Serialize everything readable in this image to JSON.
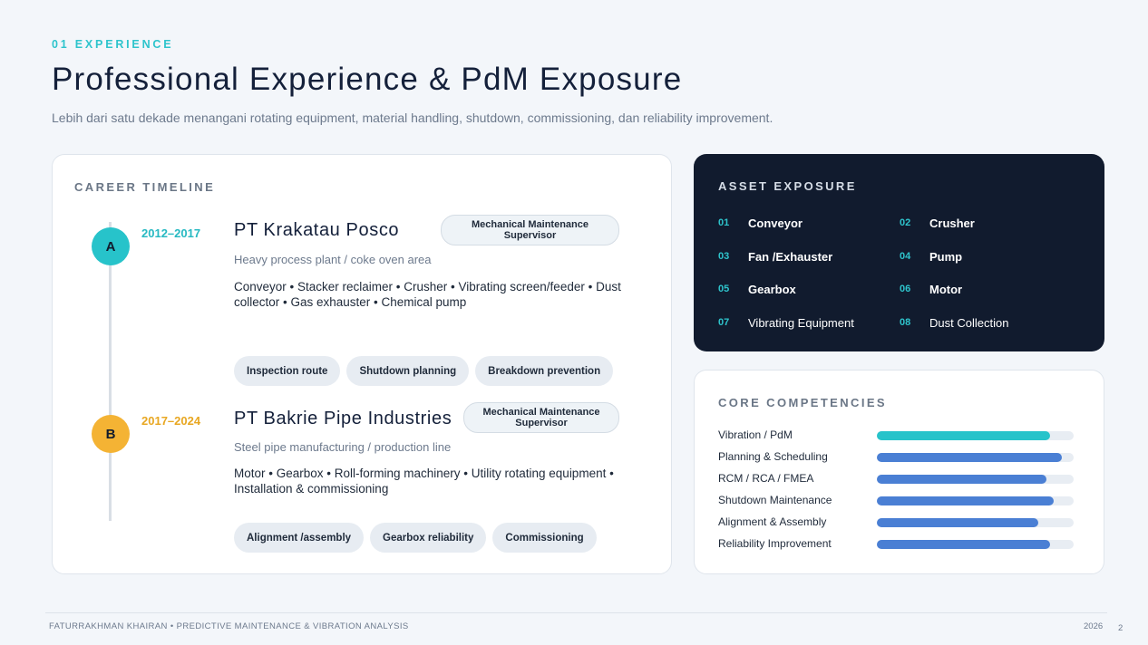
{
  "header": {
    "kicker": "01 EXPERIENCE",
    "title": "Professional Experience & PdM Exposure",
    "subtitle": "Lebih dari satu dekade menangani rotating equipment, material handling, shutdown, commissioning, dan reliability improvement."
  },
  "timeline": {
    "heading": "CAREER TIMELINE",
    "entries": [
      {
        "marker": "A",
        "period": "2012–2017",
        "company": "PT Krakatau Posco",
        "role": "Mechanical Maintenance Supervisor",
        "description": "Heavy process plant / coke oven area",
        "assets": "Conveyor • Stacker reclaimer • Crusher • Vibrating screen/feeder • Dust collector • Gas exhauster • Chemical pump",
        "tags": [
          "Inspection route",
          "Shutdown planning",
          "Breakdown prevention"
        ],
        "color": "#27c3ca"
      },
      {
        "marker": "B",
        "period": "2017–2024",
        "company": "PT Bakrie Pipe Industries",
        "role": "Mechanical Maintenance Supervisor",
        "description": "Steel pipe manufacturing / production line",
        "assets": "Motor • Gearbox • Roll-forming machinery • Utility rotating equipment • Installation & commissioning",
        "tags": [
          "Alignment /assembly",
          "Gearbox reliability",
          "Commissioning"
        ],
        "color": "#f4b334"
      }
    ]
  },
  "asset_exposure": {
    "heading": "ASSET EXPOSURE",
    "items": [
      {
        "num": "01",
        "name": "Conveyor",
        "bold": true
      },
      {
        "num": "02",
        "name": "Crusher",
        "bold": true
      },
      {
        "num": "03",
        "name": "Fan /Exhauster",
        "bold": true
      },
      {
        "num": "04",
        "name": "Pump",
        "bold": true
      },
      {
        "num": "05",
        "name": "Gearbox",
        "bold": true
      },
      {
        "num": "06",
        "name": "Motor",
        "bold": true
      },
      {
        "num": "07",
        "name": "Vibrating Equipment",
        "bold": false
      },
      {
        "num": "08",
        "name": "Dust Collection",
        "bold": false
      }
    ]
  },
  "core_competencies": {
    "heading": "CORE COMPETENCIES",
    "skills": [
      {
        "label": "Vibration / PdM",
        "level": 0.88,
        "color": "#27c3ca"
      },
      {
        "label": "Planning & Scheduling",
        "level": 0.94,
        "color": "#4a7fd4"
      },
      {
        "label": "RCM / RCA / FMEA",
        "level": 0.86,
        "color": "#4a7fd4"
      },
      {
        "label": "Shutdown Maintenance",
        "level": 0.9,
        "color": "#4a7fd4"
      },
      {
        "label": "Alignment & Assembly",
        "level": 0.82,
        "color": "#4a7fd4"
      },
      {
        "label": "Reliability Improvement",
        "level": 0.88,
        "color": "#4a7fd4"
      }
    ]
  },
  "footer": {
    "left": "FATURRAKHMAN KHAIRAN • PREDICTIVE MAINTENANCE & VIBRATION ANALYSIS",
    "year": "2026",
    "page": "2"
  }
}
